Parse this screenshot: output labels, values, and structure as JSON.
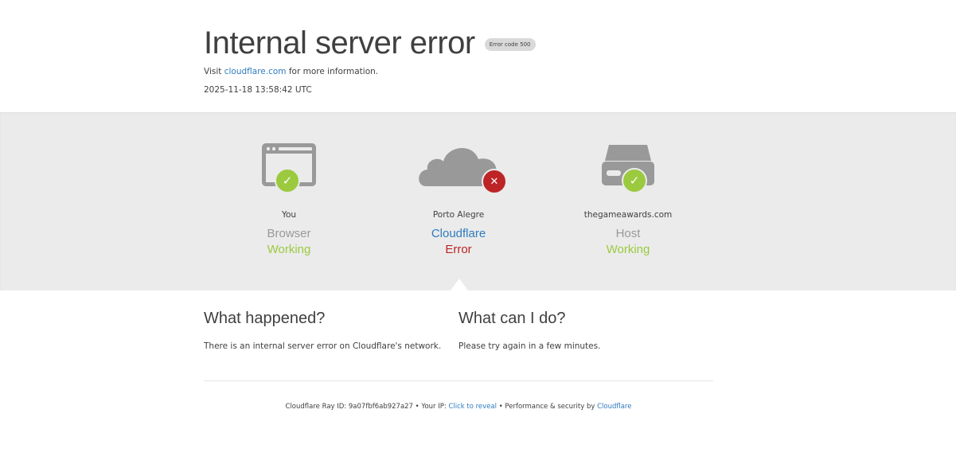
{
  "header": {
    "title": "Internal server error",
    "error_badge": "Error code 500",
    "visit_prefix": "Visit",
    "visit_link": "cloudflare.com",
    "visit_suffix": "for more information.",
    "timestamp": "2025-11-18 13:58:42 UTC"
  },
  "nodes": [
    {
      "location": "You",
      "role": "Browser",
      "state": "Working",
      "icon": "browser-icon",
      "status": "ok"
    },
    {
      "location": "Porto Alegre",
      "role": "Cloudflare",
      "state": "Error",
      "icon": "cloud-icon",
      "status": "error"
    },
    {
      "location": "thegameawards.com",
      "role": "Host",
      "state": "Working",
      "icon": "server-icon",
      "status": "ok"
    }
  ],
  "what_happened": {
    "heading": "What happened?",
    "text": "There is an internal server error on Cloudflare's network."
  },
  "what_can_i_do": {
    "heading": "What can I do?",
    "text": "Please try again in a few minutes."
  },
  "footer": {
    "ray_label": "Cloudflare Ray ID:",
    "ray_id": "9a07fbf6ab927a27",
    "ip_label": "Your IP:",
    "ip_link": "Click to reveal",
    "perf_label": "Performance & security by",
    "perf_link": "Cloudflare",
    "separator": "•"
  },
  "colors": {
    "ok": "#9bca3e",
    "error": "#bd2426",
    "link": "#2f7bbf",
    "band": "#ebebeb",
    "icon_gray": "#999999"
  }
}
